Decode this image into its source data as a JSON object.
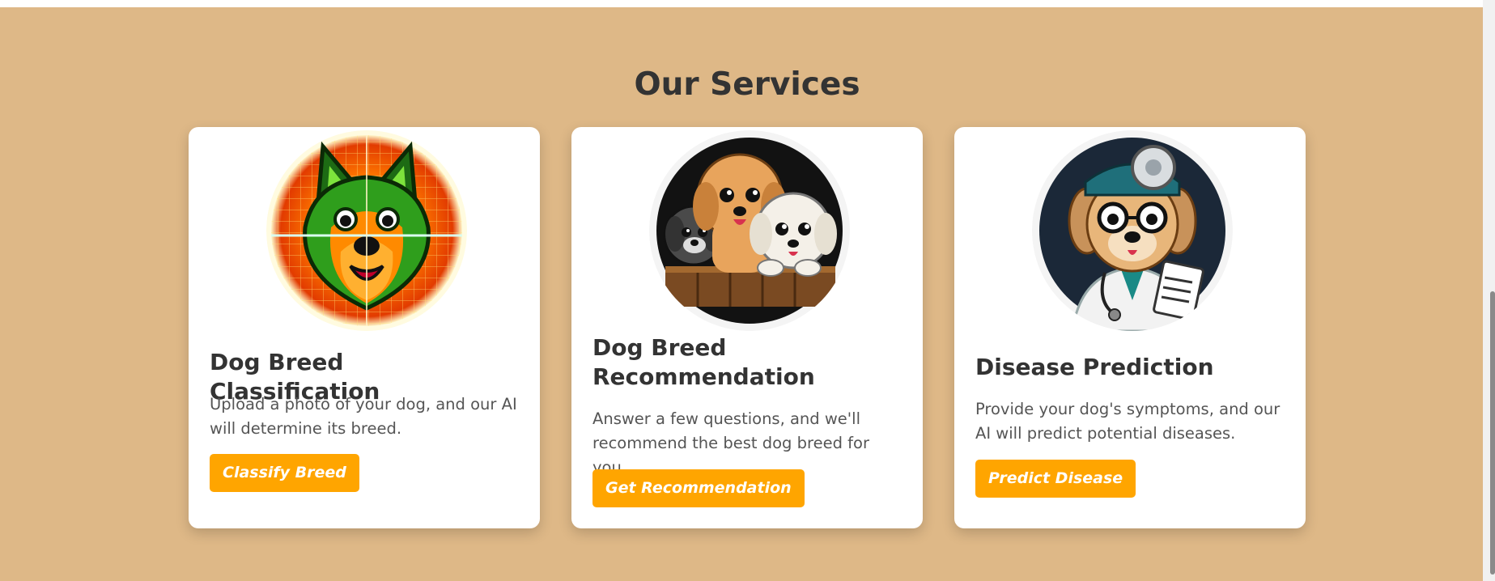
{
  "section": {
    "title": "Our Services"
  },
  "services": [
    {
      "title": "Dog Breed Classification",
      "description": "Upload a photo of your dog, and our AI will determine its breed.",
      "button_label": "Classify Breed",
      "image_icon": "scanned-dog-face-icon"
    },
    {
      "title": "Dog Breed Recommendation",
      "description": "Answer a few questions, and we'll recommend the best dog breed for you.",
      "button_label": "Get Recommendation",
      "image_icon": "three-puppies-icon"
    },
    {
      "title": "Disease Prediction",
      "description": "Provide your dog's symptoms, and our AI will predict potential diseases.",
      "button_label": "Predict Disease",
      "image_icon": "doctor-dog-icon"
    }
  ],
  "colors": {
    "section_background": "#deb887",
    "card_background": "#ffffff",
    "button": "#ffa500",
    "button_text": "#ffffff",
    "title_text": "#333333",
    "body_text": "#555555"
  }
}
